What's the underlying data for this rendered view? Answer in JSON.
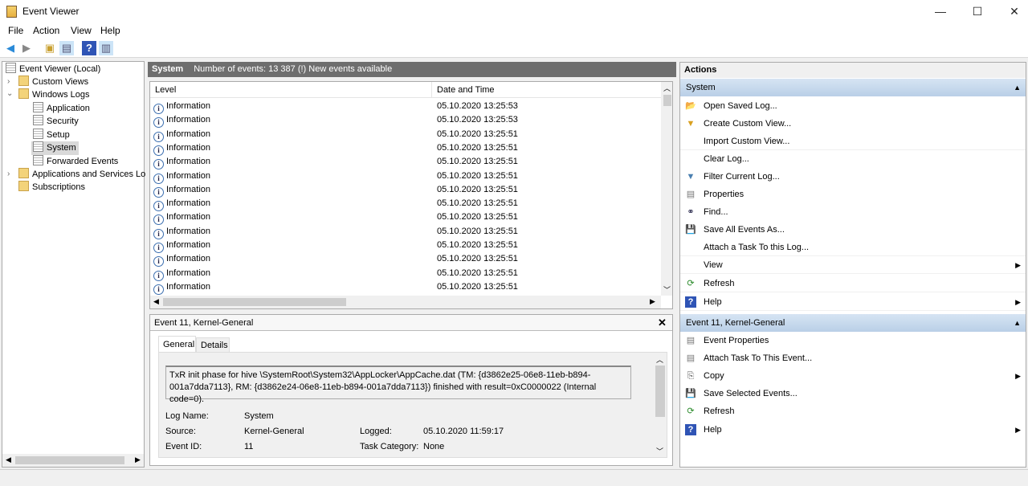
{
  "window": {
    "title": "Event Viewer",
    "minimize": "—",
    "maximize": "☐",
    "close": "✕"
  },
  "menu": [
    "File",
    "Action",
    "View",
    "Help"
  ],
  "tree": {
    "root": "Event Viewer (Local)",
    "custom_views": "Custom Views",
    "windows_logs": "Windows Logs",
    "logs": [
      "Application",
      "Security",
      "Setup",
      "System",
      "Forwarded Events"
    ],
    "apps_services": "Applications and Services Lo",
    "subscriptions": "Subscriptions"
  },
  "list": {
    "log_name": "System",
    "summary": "Number of events: 13 387 (!) New events available",
    "col_level": "Level",
    "col_date": "Date and Time",
    "rows": [
      {
        "level": "Information",
        "date": "05.10.2020 13:25:53"
      },
      {
        "level": "Information",
        "date": "05.10.2020 13:25:53"
      },
      {
        "level": "Information",
        "date": "05.10.2020 13:25:51"
      },
      {
        "level": "Information",
        "date": "05.10.2020 13:25:51"
      },
      {
        "level": "Information",
        "date": "05.10.2020 13:25:51"
      },
      {
        "level": "Information",
        "date": "05.10.2020 13:25:51"
      },
      {
        "level": "Information",
        "date": "05.10.2020 13:25:51"
      },
      {
        "level": "Information",
        "date": "05.10.2020 13:25:51"
      },
      {
        "level": "Information",
        "date": "05.10.2020 13:25:51"
      },
      {
        "level": "Information",
        "date": "05.10.2020 13:25:51"
      },
      {
        "level": "Information",
        "date": "05.10.2020 13:25:51"
      },
      {
        "level": "Information",
        "date": "05.10.2020 13:25:51"
      },
      {
        "level": "Information",
        "date": "05.10.2020 13:25:51"
      },
      {
        "level": "Information",
        "date": "05.10.2020 13:25:51"
      }
    ]
  },
  "detail": {
    "title": "Event 11, Kernel-General",
    "close": "✕",
    "tabs": [
      "General",
      "Details"
    ],
    "message": "TxR init phase for hive \\SystemRoot\\System32\\AppLocker\\AppCache.dat (TM: {d3862e25-06e8-11eb-b894-001a7dda7113}, RM: {d3862e24-06e8-11eb-b894-001a7dda7113}) finished with result=0xC0000022 (Internal code=0).",
    "log_name_label": "Log Name:",
    "log_name": "System",
    "source_label": "Source:",
    "source": "Kernel-General",
    "logged_label": "Logged:",
    "logged": "05.10.2020 11:59:17",
    "event_id_label": "Event ID:",
    "event_id": "11",
    "task_category_label": "Task Category:",
    "task_category": "None"
  },
  "actions": {
    "title": "Actions",
    "section1": "System",
    "items1": [
      "Open Saved Log...",
      "Create Custom View...",
      "Import Custom View...",
      "Clear Log...",
      "Filter Current Log...",
      "Properties",
      "Find...",
      "Save All Events As...",
      "Attach a Task To this Log...",
      "View",
      "Refresh",
      "Help"
    ],
    "section2": "Event 11, Kernel-General",
    "items2": [
      "Event Properties",
      "Attach Task To This Event...",
      "Copy",
      "Save Selected Events...",
      "Refresh",
      "Help"
    ]
  }
}
